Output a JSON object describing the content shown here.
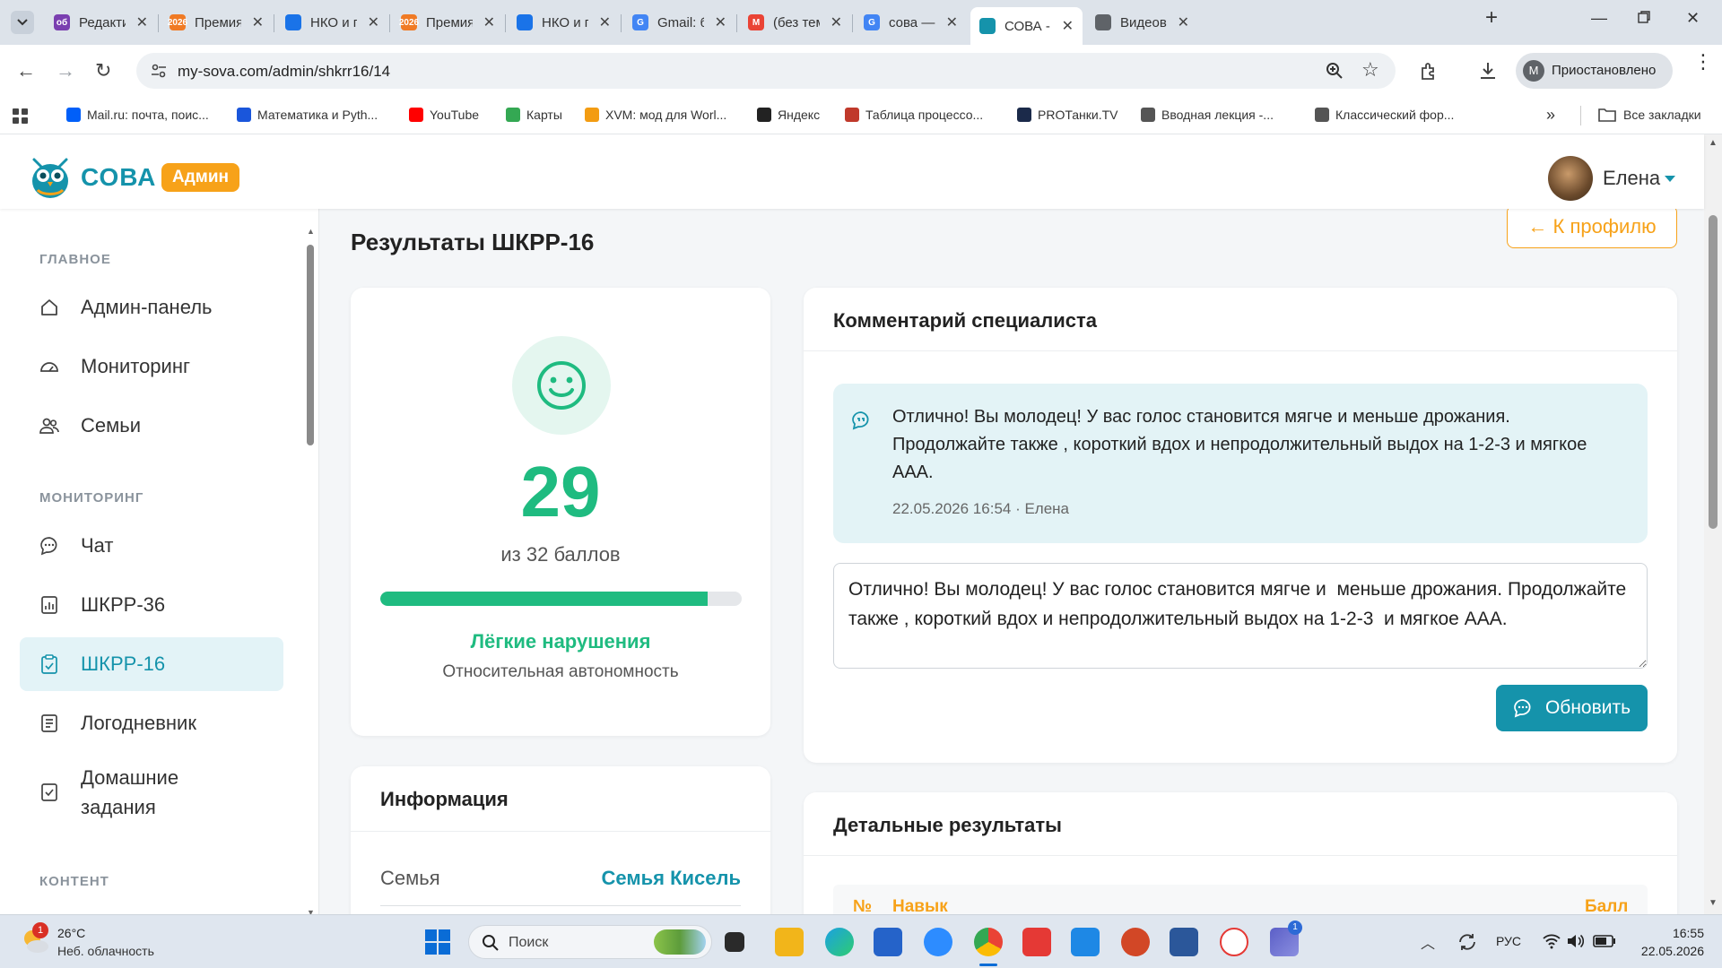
{
  "browser": {
    "tabs": [
      {
        "label": "Редактиро",
        "favicon_color": "#7a3fb0",
        "favicon_text": "об"
      },
      {
        "label": "Премия #",
        "favicon_color": "#f07a24",
        "favicon_text": "2026"
      },
      {
        "label": "НКО и про",
        "favicon_color": "#1a73e8",
        "favicon_text": ""
      },
      {
        "label": "Премия #",
        "favicon_color": "#f07a24",
        "favicon_text": "2026"
      },
      {
        "label": "НКО и про",
        "favicon_color": "#1a73e8",
        "favicon_text": ""
      },
      {
        "label": "Gmail: без",
        "favicon_color": "#4285f4",
        "favicon_text": "G"
      },
      {
        "label": "(без темы)",
        "favicon_color": "#ea4335",
        "favicon_text": "M"
      },
      {
        "label": "сова — ре",
        "favicon_color": "#4285f4",
        "favicon_text": "G"
      },
      {
        "label": "СОВА - Ад",
        "favicon_color": "#1593ab",
        "favicon_text": ""
      },
      {
        "label": "Видеовстр",
        "favicon_color": "#5f6368",
        "favicon_text": ""
      }
    ],
    "url": "my-sova.com/admin/shkrr16/14",
    "profile_label": "Приостановлено",
    "profile_initial": "M",
    "bookmarks": [
      {
        "label": "Mail.ru: почта, поис...",
        "color": "#005ff9"
      },
      {
        "label": "Математика и Pyth...",
        "color": "#1a56db"
      },
      {
        "label": "YouTube",
        "color": "#ff0000"
      },
      {
        "label": "Карты",
        "color": "#34a853"
      },
      {
        "label": "XVM: мод для Worl...",
        "color": "#f39c12"
      },
      {
        "label": "Яндекс",
        "color": "#222222"
      },
      {
        "label": "Таблица процессо...",
        "color": "#c0392b"
      },
      {
        "label": "PROТанки.TV",
        "color": "#1b2a4a"
      },
      {
        "label": "Вводная лекция -...",
        "color": "#555555"
      },
      {
        "label": "Классический фор...",
        "color": "#555555"
      }
    ],
    "all_bookmarks": "Все закладки"
  },
  "header": {
    "logo": "СОВА",
    "badge": "Админ",
    "user": "Елена"
  },
  "sidebar": {
    "sections": [
      {
        "title": "ГЛАВНОЕ",
        "items": [
          {
            "label": "Админ-панель",
            "icon": "home-icon"
          },
          {
            "label": "Мониторинг",
            "icon": "gauge-icon"
          },
          {
            "label": "Семьи",
            "icon": "users-icon"
          }
        ]
      },
      {
        "title": "МОНИТОРИНГ",
        "items": [
          {
            "label": "Чат",
            "icon": "chat-icon"
          },
          {
            "label": "ШКРР-36",
            "icon": "chart-icon"
          },
          {
            "label": "ШКРР-16",
            "icon": "clipboard-icon",
            "active": true
          },
          {
            "label": "Логодневник",
            "icon": "journal-icon"
          },
          {
            "label": "Домашние задания",
            "icon": "checklist-icon"
          }
        ]
      },
      {
        "title": "КОНТЕНТ",
        "items": []
      }
    ]
  },
  "main": {
    "title": "Результаты ШКРР-16",
    "back_button": "← К профилю",
    "score": {
      "value": "29",
      "max_text": "из 32 баллов",
      "fraction": 0.906,
      "level": "Лёгкие нарушения",
      "description": "Относительная автономность"
    },
    "info": {
      "title": "Информация",
      "rows": [
        {
          "label": "Семья",
          "value": "Семья Кисель"
        }
      ]
    },
    "comment": {
      "title": "Комментарий специалиста",
      "text": "Отлично! Вы молодец! У вас голос становится мягче и меньше дрожания. Продолжайте также , короткий вдох и непродолжительный выдох на 1-2-3 и мягкое ААА.",
      "meta": "22.05.2026 16:54 · Елена",
      "textarea_value": "Отлично! Вы молодец! У вас голос становится мягче и  меньше дрожания. Продолжайте также , короткий вдох и непродолжительный выдох на 1-2-3  и мягкое ААА.",
      "button": "Обновить"
    },
    "details": {
      "title": "Детальные результаты",
      "columns": [
        "№",
        "Навык",
        "Балл"
      ]
    }
  },
  "taskbar": {
    "weather_temp": "26°C",
    "weather_desc": "Неб. облачность",
    "weather_badge": "1",
    "search": "Поиск",
    "lang": "РУС",
    "time": "16:55",
    "date": "22.05.2026",
    "teams_badge": "1"
  },
  "colors": {
    "accent": "#1593ab",
    "success": "#1fbb80",
    "badge": "#f7a219"
  }
}
